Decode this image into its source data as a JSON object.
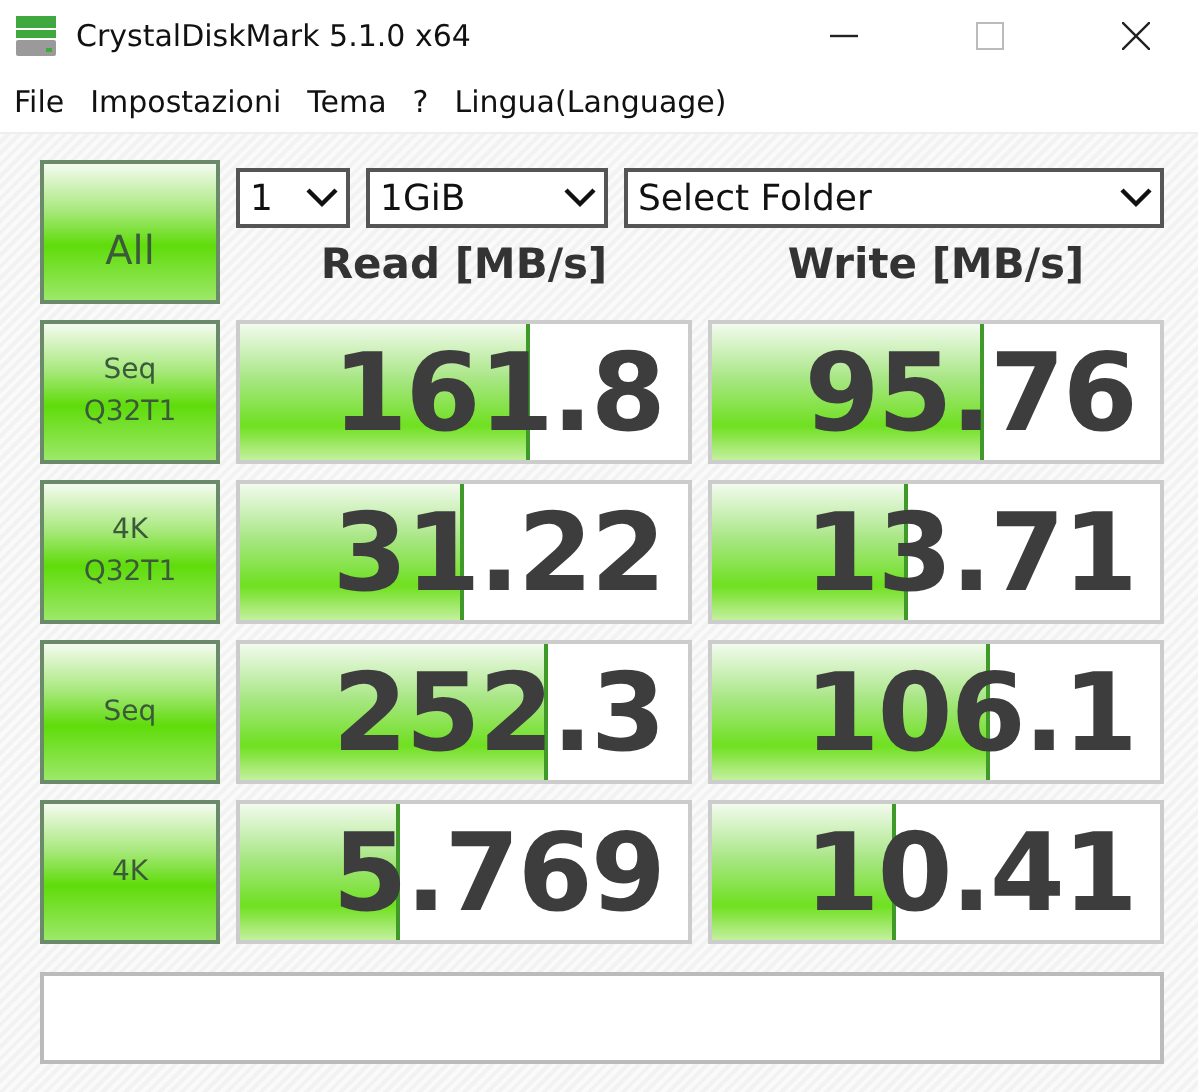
{
  "window": {
    "title": "CrystalDiskMark 5.1.0 x64"
  },
  "menu": [
    "File",
    "Impostazioni",
    "Tema",
    "?",
    "Lingua(Language)"
  ],
  "all_button": "All",
  "selectors": [
    {
      "value": "1"
    },
    {
      "value": "1GiB"
    },
    {
      "value": "Select Folder"
    }
  ],
  "headers": [
    "Read [MB/s]",
    "Write [MB/s]"
  ],
  "rows": [
    {
      "test": "Seq\nQ32T1",
      "read": {
        "value": "161.8",
        "level": 0.64
      },
      "write": {
        "value": "95.76",
        "level": 0.6
      }
    },
    {
      "test": "4K\nQ32T1",
      "read": {
        "value": "31.22",
        "level": 0.49
      },
      "write": {
        "value": "13.71",
        "level": 0.43
      }
    },
    {
      "test": "Seq",
      "read": {
        "value": "252.3",
        "level": 0.68
      },
      "write": {
        "value": "106.1",
        "level": 0.61
      }
    },
    {
      "test": "4K",
      "read": {
        "value": "5.769",
        "level": 0.35
      },
      "write": {
        "value": "10.41",
        "level": 0.4
      }
    }
  ]
}
